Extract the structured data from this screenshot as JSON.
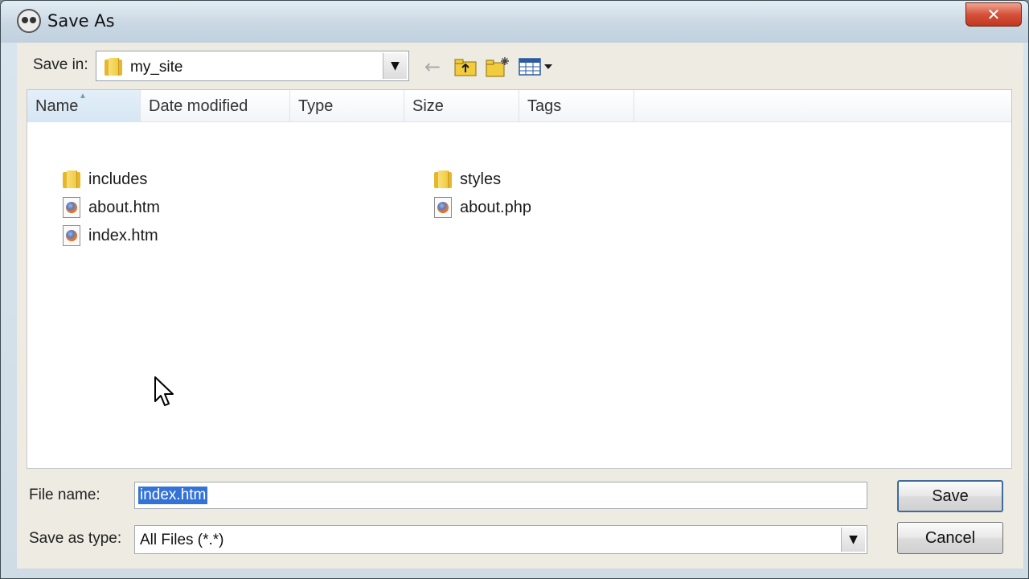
{
  "window": {
    "title": "Save As",
    "close_label": "✕"
  },
  "toolbar": {
    "save_in_label": "Save in:",
    "save_in_value": "my_site"
  },
  "columns": [
    {
      "label": "Name"
    },
    {
      "label": "Date modified"
    },
    {
      "label": "Type"
    },
    {
      "label": "Size"
    },
    {
      "label": "Tags"
    }
  ],
  "files": [
    {
      "name": "includes",
      "kind": "folder-icon"
    },
    {
      "name": "about.htm",
      "kind": "htm-file-icon"
    },
    {
      "name": "index.htm",
      "kind": "htm-file-icon"
    },
    {
      "name": "styles",
      "kind": "folder-icon"
    },
    {
      "name": "about.php",
      "kind": "php-file-icon"
    }
  ],
  "form": {
    "file_name_label": "File name:",
    "file_name_value": "index.htm",
    "save_as_type_label": "Save as type:",
    "save_as_type_value": "All Files (*.*)"
  },
  "buttons": {
    "save": "Save",
    "cancel": "Cancel"
  },
  "colors": {
    "selection": "#3372d7",
    "close": "#c1371f",
    "folder": "#e6b72e"
  }
}
